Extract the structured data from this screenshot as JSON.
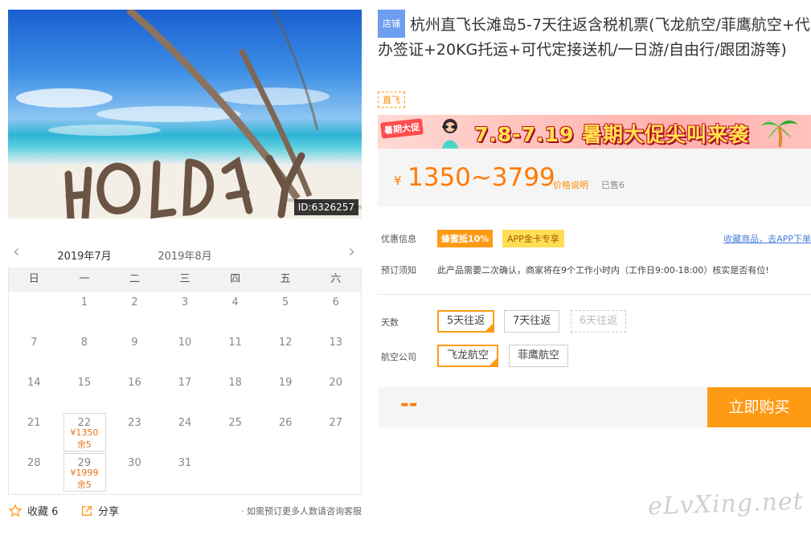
{
  "hero": {
    "image_id": "ID:6326257",
    "sign_text": "HOLIDAY"
  },
  "calendar": {
    "tabs": [
      "2019年7月",
      "2019年8月"
    ],
    "active_tab": 0,
    "weekdays": [
      "日",
      "一",
      "二",
      "三",
      "四",
      "五",
      "六"
    ],
    "weeks": [
      [
        {
          "d": ""
        },
        {
          "d": "1"
        },
        {
          "d": "2"
        },
        {
          "d": "3"
        },
        {
          "d": "4"
        },
        {
          "d": "5"
        },
        {
          "d": "6"
        }
      ],
      [
        {
          "d": "7"
        },
        {
          "d": "8"
        },
        {
          "d": "9"
        },
        {
          "d": "10"
        },
        {
          "d": "11"
        },
        {
          "d": "12"
        },
        {
          "d": "13"
        }
      ],
      [
        {
          "d": "14"
        },
        {
          "d": "15"
        },
        {
          "d": "16"
        },
        {
          "d": "17"
        },
        {
          "d": "18"
        },
        {
          "d": "19"
        },
        {
          "d": "20"
        }
      ],
      [
        {
          "d": "21"
        },
        {
          "d": "22",
          "price": "¥1350",
          "stock": "余5"
        },
        {
          "d": "23"
        },
        {
          "d": "24"
        },
        {
          "d": "25"
        },
        {
          "d": "26"
        },
        {
          "d": "27"
        }
      ],
      [
        {
          "d": "28"
        },
        {
          "d": "29",
          "price": "¥1999",
          "stock": "余5"
        },
        {
          "d": "30"
        },
        {
          "d": "31"
        },
        {
          "d": ""
        },
        {
          "d": ""
        },
        {
          "d": ""
        }
      ]
    ]
  },
  "footer": {
    "favorite_label": "收藏 6",
    "share_label": "分享",
    "hint": "· 如需预订更多人数请咨询客服"
  },
  "product": {
    "shop_tag": "店铺",
    "title": "杭州直飞长滩岛5-7天往返含税机票(飞龙航空/菲鹰航空+代办签证+20KG托运+可代定接送机/一日游/自由行/跟团游等)",
    "direct_tag": "直飞"
  },
  "banner": {
    "badge": "暑期大促",
    "text": "7.8-7.19 暑期大促尖叫来袭"
  },
  "price": {
    "currency": "¥",
    "range": "1350~3799",
    "note": "价格说明",
    "sold": "已售6"
  },
  "promo": {
    "label": "优惠信息",
    "badge1": "蜂蜜抵10%",
    "badge2": "APP金卡专享",
    "link": "收藏商品，去APP下单"
  },
  "notice": {
    "label": "预订须知",
    "text": "此产品需要二次确认，商家将在9个工作小时内（工作日9:00-18:00）核实是否有位!"
  },
  "options": {
    "days": {
      "label": "天数",
      "items": [
        {
          "text": "5天往返",
          "state": "selected"
        },
        {
          "text": "7天往返",
          "state": "normal"
        },
        {
          "text": "6天往返",
          "state": "disabled"
        }
      ]
    },
    "airline": {
      "label": "航空公司",
      "items": [
        {
          "text": "飞龙航空",
          "state": "selected"
        },
        {
          "text": "菲鹰航空",
          "state": "normal"
        }
      ]
    }
  },
  "buy": {
    "total": "--",
    "button": "立即购买"
  },
  "watermark": "eLvXing.net",
  "colors": {
    "accent": "#ff9a14",
    "price": "#ff7a00",
    "link": "#4a7fd8"
  }
}
